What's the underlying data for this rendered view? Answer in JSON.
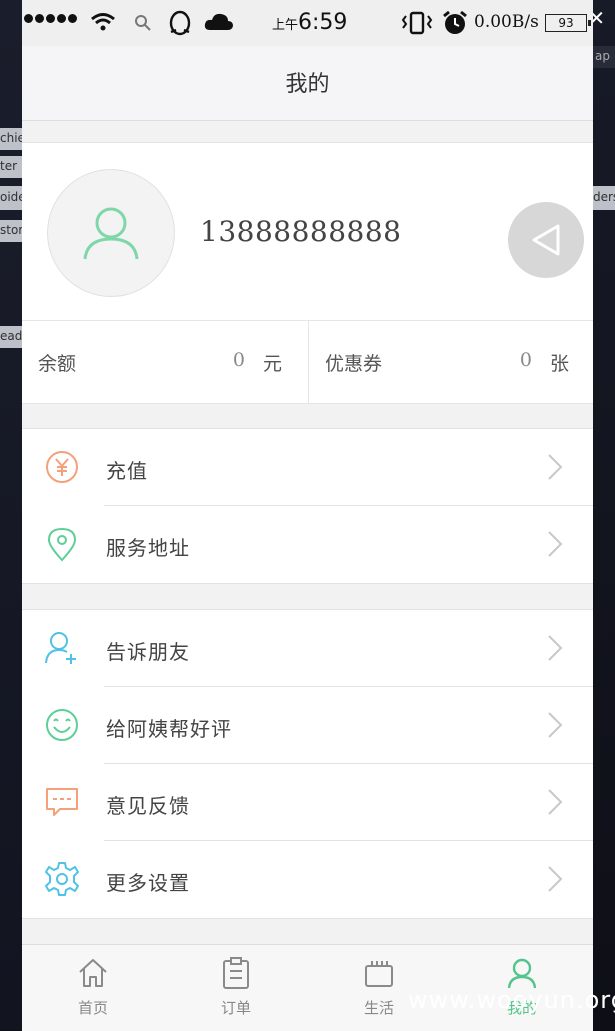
{
  "overlay": {
    "close_glyph": "✕",
    "side_text_left": [
      "chie",
      "ter",
      "oide",
      "stor",
      "eade"
    ],
    "side_text_right": [
      "ap",
      "ders"
    ],
    "watermark": "www.wooyun.org"
  },
  "status_bar": {
    "time_prefix": "上午",
    "time": "6:59",
    "network_speed": "0.00B/s",
    "battery": "93",
    "icons": [
      "signal-dots-icon",
      "wifi-icon",
      "search-icon",
      "qq-icon",
      "cloud-icon",
      "vibrate-icon",
      "alarm-icon"
    ]
  },
  "navbar": {
    "title": "我的"
  },
  "profile": {
    "phone_number": "13888888888",
    "avatar_icon": "user-icon",
    "action_icon": "back-triangle-icon"
  },
  "balance": {
    "balance_label": "余额",
    "balance_value": "0",
    "balance_unit": "元",
    "coupon_label": "优惠券",
    "coupon_value": "0",
    "coupon_unit": "张"
  },
  "menu_group_1": [
    {
      "label": "充值",
      "icon": "yuan-coin-icon",
      "color": "#f5a07a"
    },
    {
      "label": "服务地址",
      "icon": "location-pin-icon",
      "color": "#5ccf97"
    }
  ],
  "menu_group_2": [
    {
      "label": "告诉朋友",
      "icon": "add-user-icon",
      "color": "#4ec3e6"
    },
    {
      "label": "给阿姨帮好评",
      "icon": "smile-icon",
      "color": "#5ccf97"
    },
    {
      "label": "意见反馈",
      "icon": "message-icon",
      "color": "#f5a07a"
    },
    {
      "label": "更多设置",
      "icon": "gear-icon",
      "color": "#4ec3e6"
    }
  ],
  "tabbar": {
    "tabs": [
      {
        "label": "首页",
        "icon": "home-icon"
      },
      {
        "label": "订单",
        "icon": "clipboard-icon"
      },
      {
        "label": "生活",
        "icon": "life-icon"
      },
      {
        "label": "我的",
        "icon": "user-tab-icon",
        "active": true
      }
    ],
    "active_color": "#53c48c"
  }
}
